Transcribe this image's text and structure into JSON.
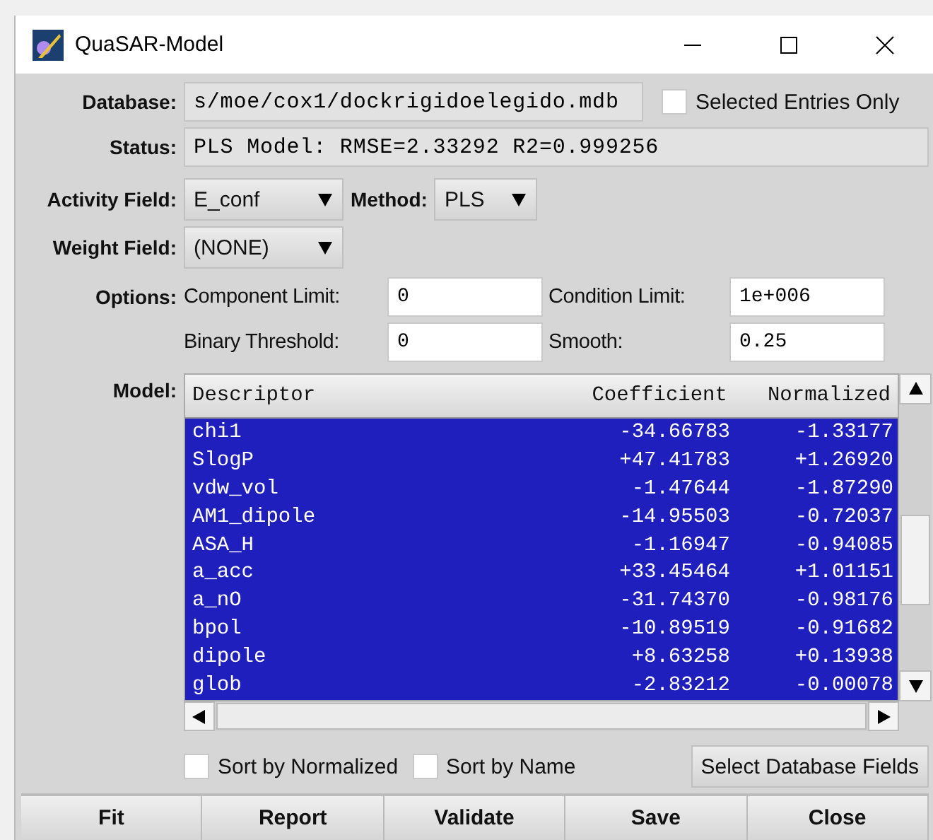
{
  "window": {
    "title": "QuaSAR-Model"
  },
  "database": {
    "label": "Database:",
    "value": "s/moe/cox1/dockrigidoelegido.mdb",
    "selected_only": {
      "label": "Selected Entries Only",
      "checked": false
    }
  },
  "status": {
    "label": "Status:",
    "value": "PLS Model: RMSE=2.33292 R2=0.999256"
  },
  "activity_field": {
    "label": "Activity Field:",
    "value": "E_conf"
  },
  "method": {
    "label": "Method:",
    "value": "PLS"
  },
  "weight_field": {
    "label": "Weight Field:",
    "value": "(NONE)"
  },
  "options": {
    "label": "Options:",
    "fields": [
      {
        "label": "Component Limit:",
        "value": "0"
      },
      {
        "label": "Condition Limit:",
        "value": "1e+006"
      },
      {
        "label": "Binary Threshold:",
        "value": "0"
      },
      {
        "label": "Smooth:",
        "value": "0.25"
      }
    ]
  },
  "model": {
    "label": "Model:",
    "columns": [
      "Descriptor",
      "Coefficient",
      "Normalized"
    ],
    "rows": [
      {
        "cells": [
          "chi1",
          "-34.66783",
          "-1.33177"
        ],
        "selected": true
      },
      {
        "cells": [
          "SlogP",
          "+47.41783",
          "+1.26920"
        ],
        "selected": true
      },
      {
        "cells": [
          "vdw_vol",
          "-1.47644",
          "-1.87290"
        ],
        "selected": true
      },
      {
        "cells": [
          "AM1_dipole",
          "-14.95503",
          "-0.72037"
        ],
        "selected": true
      },
      {
        "cells": [
          "ASA_H",
          "-1.16947",
          "-0.94085"
        ],
        "selected": true
      },
      {
        "cells": [
          "a_acc",
          "+33.45464",
          "+1.01151"
        ],
        "selected": true
      },
      {
        "cells": [
          "a_nO",
          "-31.74370",
          "-0.98176"
        ],
        "selected": true
      },
      {
        "cells": [
          "bpol",
          "-10.89519",
          "-0.91682"
        ],
        "selected": true
      },
      {
        "cells": [
          "dipole",
          "+8.63258",
          "+0.13938"
        ],
        "selected": true
      },
      {
        "cells": [
          "glob",
          "-2.83212",
          "-0.00078"
        ],
        "selected": true
      }
    ]
  },
  "sort_options": [
    {
      "label": "Sort by Normalized",
      "checked": false
    },
    {
      "label": "Sort by Name",
      "checked": false
    }
  ],
  "select_fields_button": "Select Database Fields",
  "buttons": [
    "Fit",
    "Report",
    "Validate",
    "Save",
    "Close"
  ]
}
